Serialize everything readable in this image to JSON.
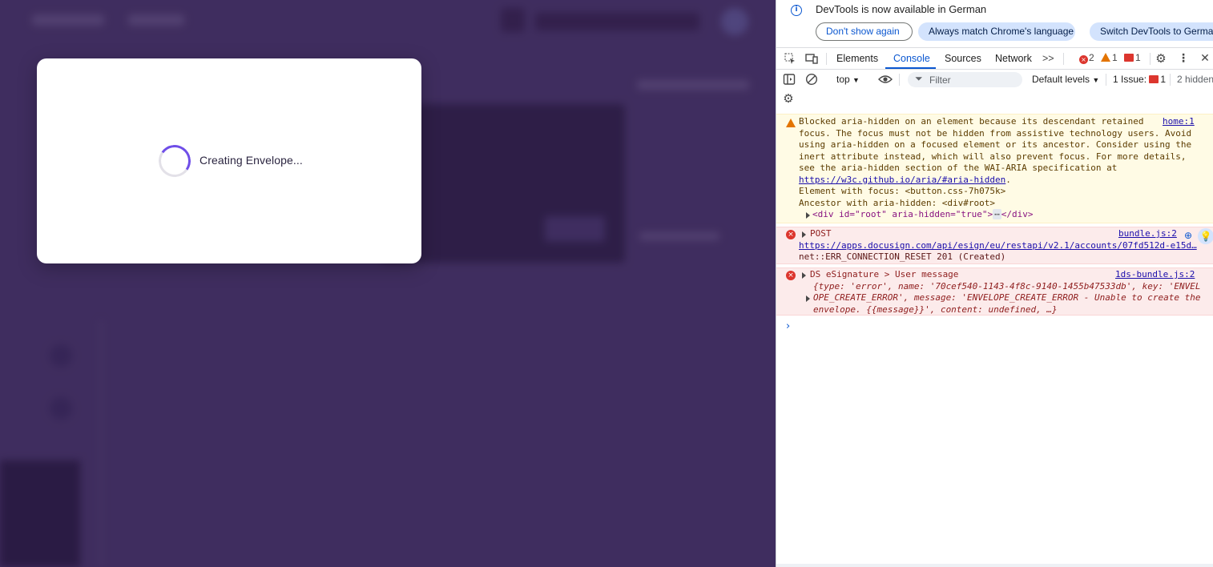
{
  "app": {
    "modal": {
      "status_text": "Creating Envelope..."
    }
  },
  "devtools": {
    "infobar": {
      "message": "DevTools is now available in German",
      "dont_show_again": "Don't show again",
      "always_match": "Always match Chrome's language",
      "switch_lang": "Switch DevTools to Germa"
    },
    "tabs": {
      "elements": "Elements",
      "console": "Console",
      "sources": "Sources",
      "network": "Network",
      "more": ">>"
    },
    "counts": {
      "errors": "2",
      "warnings": "1",
      "issues": "1"
    },
    "toolbar": {
      "context": "top",
      "filter_placeholder": "Filter",
      "levels": "Default levels",
      "issues_label": "1 Issue:",
      "issues_count": "1",
      "hidden": "2 hidden"
    },
    "messages": {
      "warn": {
        "source": "home:1",
        "lines": [
          "Blocked aria-hidden on an element because its descendant retained",
          "focus. The focus must not be hidden from assistive technology users. Avoid",
          "using aria-hidden on a focused element or its ancestor. Consider using the",
          "inert attribute instead, which will also prevent focus. For more details,",
          "see the aria-hidden section of the WAI-ARIA specification at"
        ],
        "link": "https://w3c.github.io/aria/#aria-hidden",
        "link_suffix": ".",
        "focus_line": "Element with focus: <button.css-7h075k>",
        "ancestor_line": "Ancestor with aria-hidden: <div#root>",
        "node_line": "<div id=\"root\" aria-hidden=\"true\">",
        "node_ellipsis": "⋯",
        "node_close": "</div>"
      },
      "post": {
        "label": "POST",
        "source": "bundle.js:2",
        "url": "https://apps.docusign.com/api/esign/eu/restapi/v2.1/accounts/07fd512d-e15d…",
        "status": "net::ERR_CONNECTION_RESET 201 (Created)"
      },
      "ds": {
        "label": "DS eSignature > User message",
        "source": "1ds-bundle.js:2",
        "obj_line1": "{type: 'error', name: '70cef540-1143-4f8c-9140-1455b47533db', key: 'ENVEL",
        "obj_line2": "OPE_CREATE_ERROR', message: 'ENVELOPE_CREATE_ERROR - Unable to create the",
        "obj_line3": "envelope. {{message}}', content: undefined, …}"
      }
    },
    "prompt": "›"
  }
}
